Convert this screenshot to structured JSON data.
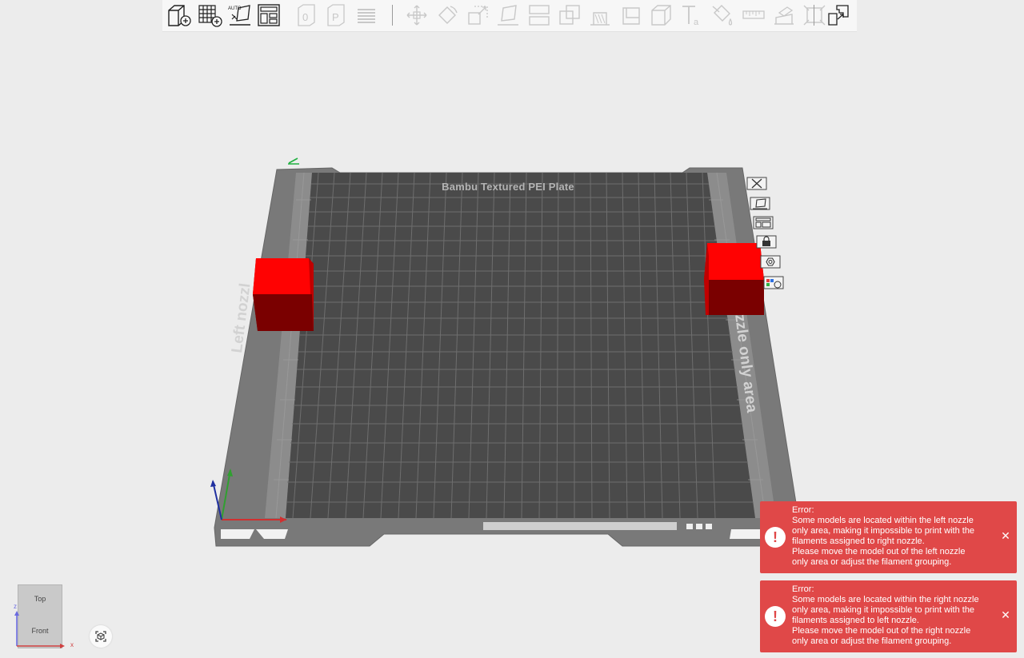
{
  "plate": {
    "name": "Bambu Textured PEI Plate",
    "left_zone_label": "Left nozzl",
    "right_zone_label": "zzle only area"
  },
  "view_cube": {
    "top_label": "Top",
    "front_label": "Front",
    "z_axis": "z",
    "x_axis": "x"
  },
  "toolbar": {
    "auto_label": "AUTO",
    "icons": [
      "add-object-icon",
      "add-plate-icon",
      "auto-arrange-icon",
      "arrange-icon",
      "orient-icon",
      "plate-icon",
      "layers-icon",
      "move-icon",
      "rotate-icon",
      "scale-icon",
      "lay-on-face-icon",
      "cut-icon",
      "boolean-icon",
      "support-paint-icon",
      "seam-paint-icon",
      "mesh-boolean-icon",
      "text-icon",
      "color-paint-icon",
      "measure-icon",
      "assembly-icon",
      "fit-view-icon",
      "explode-icon"
    ]
  },
  "plate_tools": [
    "delete-plate-icon",
    "orient-plate-icon",
    "arrange-plate-icon",
    "lock-plate-icon",
    "plate-settings-icon",
    "filament-group-icon"
  ],
  "errors": [
    {
      "title": "Error:",
      "lines": [
        "Some models are located within the left nozzle",
        "only area, making it impossible to print with the",
        "filaments assigned to right nozzle.",
        "Please move the model out of the left nozzle",
        "only area or adjust the filament grouping."
      ]
    },
    {
      "title": "Error:",
      "lines": [
        "Some models are located within the right nozzle",
        "only area, making it impossible to print with the",
        "filaments assigned to left nozzle.",
        "Please move the model out of the right nozzle",
        "only area or adjust the filament grouping."
      ]
    }
  ],
  "colors": {
    "background": "#ececec",
    "plate_frame": "#7a7a7a",
    "plate_bed": "#4a4a4a",
    "model": "#ff0000",
    "error": "#e04848"
  }
}
